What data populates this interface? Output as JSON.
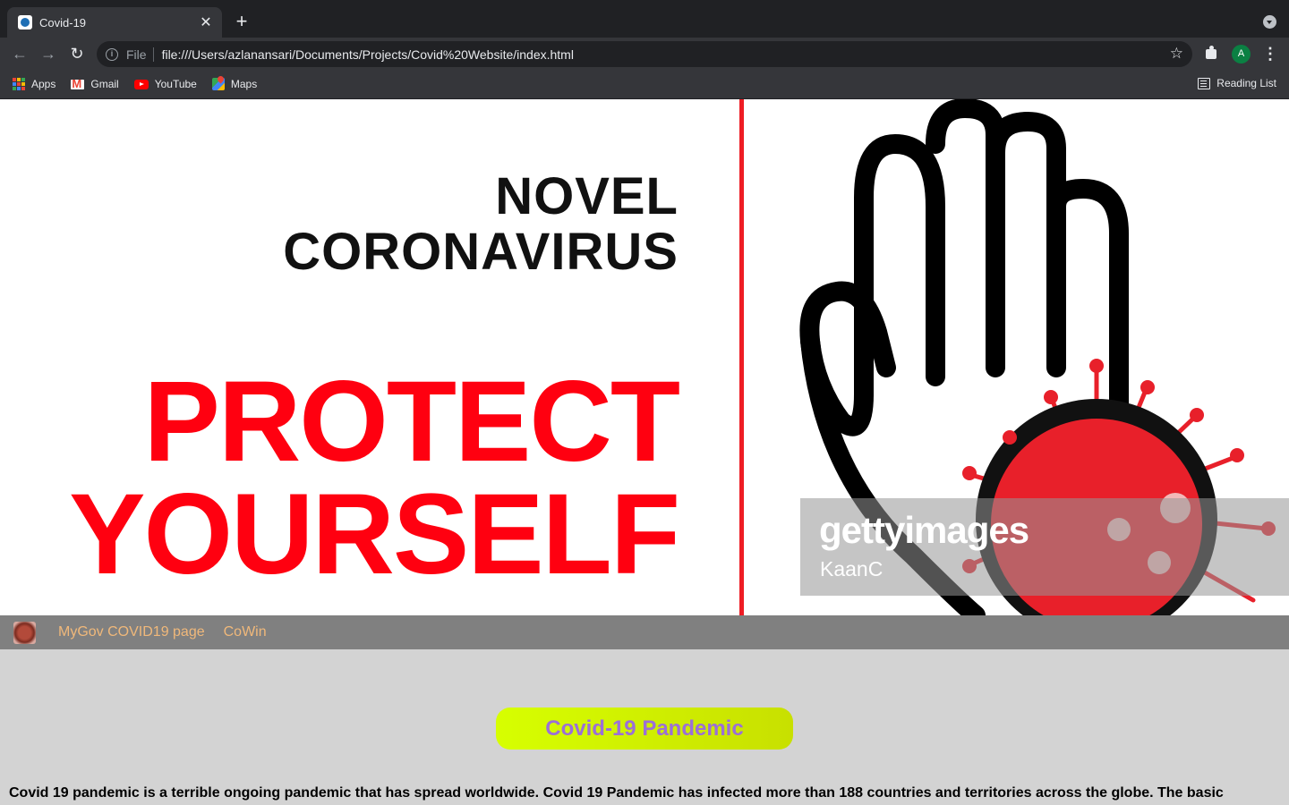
{
  "browser": {
    "tab_title": "Covid-19",
    "url_scheme": "File",
    "url": "file:///Users/azlanansari/Documents/Projects/Covid%20Website/index.html",
    "profile_initial": "A",
    "bookmarks": [
      {
        "label": "Apps",
        "icon": "apps-icon"
      },
      {
        "label": "Gmail",
        "icon": "gmail-icon"
      },
      {
        "label": "YouTube",
        "icon": "youtube-icon"
      },
      {
        "label": "Maps",
        "icon": "maps-icon"
      }
    ],
    "reading_list": "Reading List"
  },
  "hero": {
    "line1": "NOVEL",
    "line2": "CORONAVIRUS",
    "line3": "PROTECT",
    "line4": "YOURSELF",
    "watermark_logo": "gettyimages",
    "watermark_credit": "KaanC",
    "accent_red": "#ff0010"
  },
  "nav": {
    "links": [
      "MyGov COVID19 page",
      "CoWin"
    ],
    "link_color": "#f0b87a",
    "bar_color": "#808080"
  },
  "main": {
    "heading": "Covid-19 Pandemic",
    "paragraph": "Covid 19 pandemic is a terrible ongoing pandemic that has spread worldwide. Covid 19 Pandemic has infected more than 188 countries and territories across the globe. The basic"
  }
}
